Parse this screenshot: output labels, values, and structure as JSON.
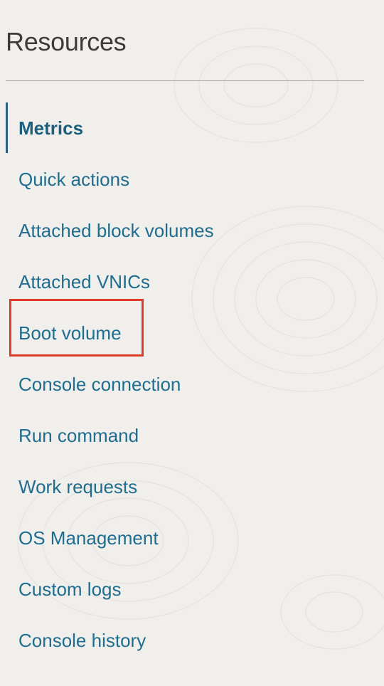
{
  "panel": {
    "title": "Resources"
  },
  "nav": {
    "items": [
      {
        "label": "Metrics",
        "active": true
      },
      {
        "label": "Quick actions"
      },
      {
        "label": "Attached block volumes"
      },
      {
        "label": "Attached VNICs"
      },
      {
        "label": "Boot volume",
        "highlighted": true
      },
      {
        "label": "Console connection"
      },
      {
        "label": "Run command"
      },
      {
        "label": "Work requests"
      },
      {
        "label": "OS Management"
      },
      {
        "label": "Custom logs"
      },
      {
        "label": "Console history"
      }
    ]
  },
  "colors": {
    "background": "#f1efec",
    "link": "#1f6d8f",
    "active_link": "#1d5f7c",
    "active_indicator": "#2a5f80",
    "highlight_box": "#e03a28",
    "title": "#3f3b36",
    "divider": "#aaa59f"
  }
}
